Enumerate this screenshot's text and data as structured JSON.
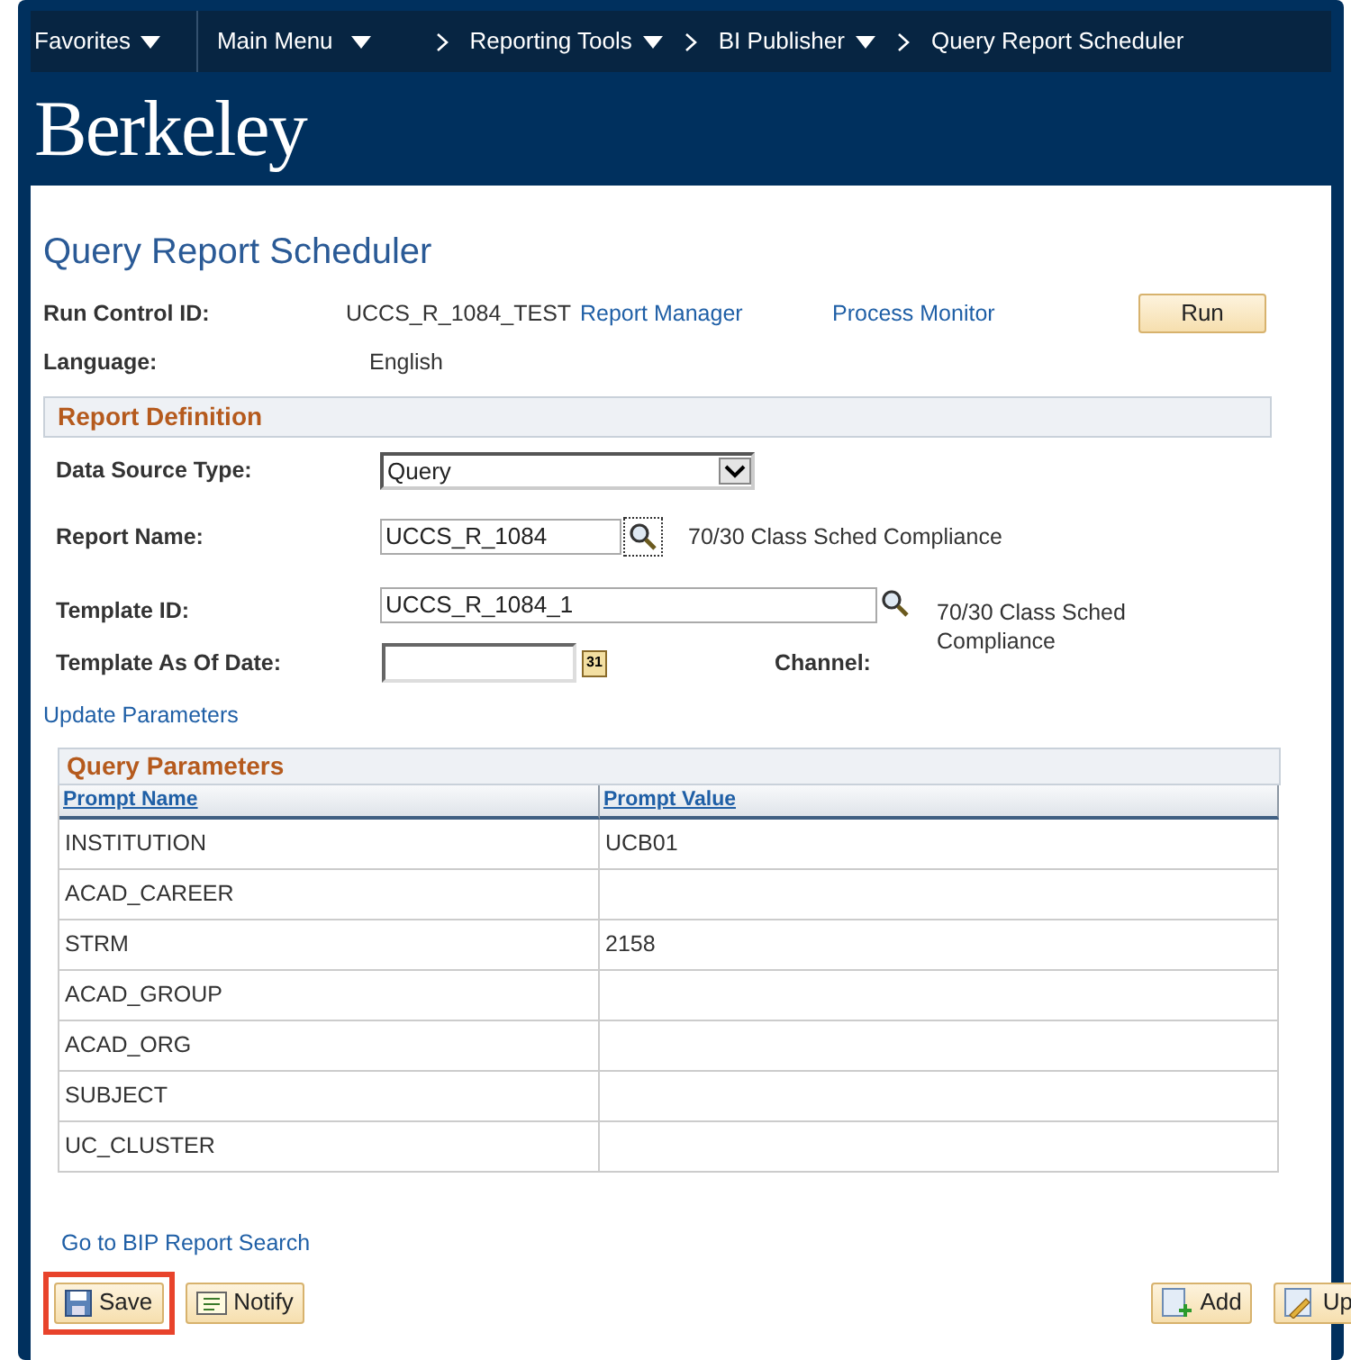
{
  "nav": {
    "items": [
      {
        "label": "Favorites",
        "kind": "menu"
      },
      {
        "label": "Main Menu",
        "kind": "menu"
      },
      {
        "label": "Reporting Tools",
        "kind": "crumb-menu"
      },
      {
        "label": "BI Publisher",
        "kind": "crumb-menu"
      },
      {
        "label": "Query Report Scheduler",
        "kind": "crumb"
      }
    ]
  },
  "logo": "Berkeley",
  "page_title": "Query Report Scheduler",
  "run_control": {
    "label": "Run Control ID:",
    "value": "UCCS_R_1084_TEST",
    "links": [
      "Report Manager",
      "Process Monitor"
    ],
    "run_button": "Run"
  },
  "language": {
    "label": "Language:",
    "value": "English"
  },
  "report_definition": {
    "title": "Report Definition",
    "data_source_type": {
      "label": "Data Source Type:",
      "value": "Query"
    },
    "report_name": {
      "label": "Report Name:",
      "value": "UCCS_R_1084",
      "description": "70/30 Class Sched Compliance"
    },
    "template_id": {
      "label": "Template ID:",
      "value": "UCCS_R_1084_1",
      "description": "70/30 Class Sched Compliance"
    },
    "template_date": {
      "label": "Template As Of Date:",
      "calendar": "31"
    },
    "channel": {
      "label": "Channel:"
    }
  },
  "update_parameters": "Update Parameters",
  "query_parameters": {
    "title": "Query Parameters",
    "columns": [
      "Prompt Name",
      "Prompt Value"
    ],
    "rows": [
      [
        "INSTITUTION",
        "UCB01"
      ],
      [
        "ACAD_CAREER",
        ""
      ],
      [
        "STRM",
        "2158"
      ],
      [
        "ACAD_GROUP",
        ""
      ],
      [
        "ACAD_ORG",
        ""
      ],
      [
        "SUBJECT",
        ""
      ],
      [
        "UC_CLUSTER",
        ""
      ]
    ]
  },
  "bip_link": "Go to BIP Report Search",
  "button_groups": [
    [
      {
        "label": "Save",
        "kind": "save",
        "highlighted": true
      },
      {
        "label": "Notify",
        "kind": "notify",
        "highlighted": false
      }
    ],
    [
      {
        "label": "Add",
        "kind": "add",
        "highlighted": false
      },
      {
        "label": "Up",
        "kind": "update",
        "highlighted": false
      }
    ]
  ]
}
